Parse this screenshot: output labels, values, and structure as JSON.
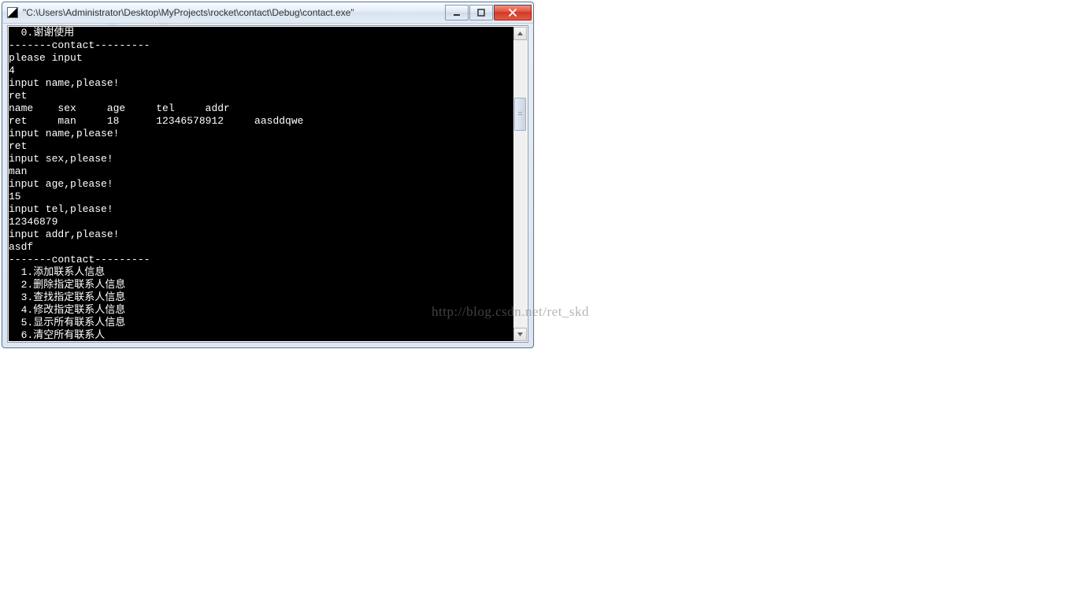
{
  "window": {
    "title": "\"C:\\Users\\Administrator\\Desktop\\MyProjects\\rocket\\contact\\Debug\\contact.exe\""
  },
  "controls": {
    "minimize": "minimize",
    "maximize": "maximize",
    "close": "close"
  },
  "console": {
    "lines": [
      "  0.谢谢使用",
      "-------contact---------",
      "please input",
      "4",
      "input name,please!",
      "ret",
      "name    sex     age     tel     addr",
      "ret     man     18      12346578912     aasddqwe",
      "input name,please!",
      "ret",
      "input sex,please!",
      "man",
      "input age,please!",
      "15",
      "input tel,please!",
      "12346879",
      "input addr,please!",
      "asdf",
      "-------contact---------"
    ],
    "menu": [
      {
        "num": "  1.",
        "label": "添加联系人信息"
      },
      {
        "num": "  2.",
        "label": "删除指定联系人信息"
      },
      {
        "num": "  3.",
        "label": "查找指定联系人信息"
      },
      {
        "num": "  4.",
        "label": "修改指定联系人信息"
      },
      {
        "num": "  5.",
        "label": "显示所有联系人信息"
      },
      {
        "num": "  6.",
        "label": "清空所有联系人"
      }
    ]
  },
  "watermark": "http://blog.csdn.net/ret_skd"
}
